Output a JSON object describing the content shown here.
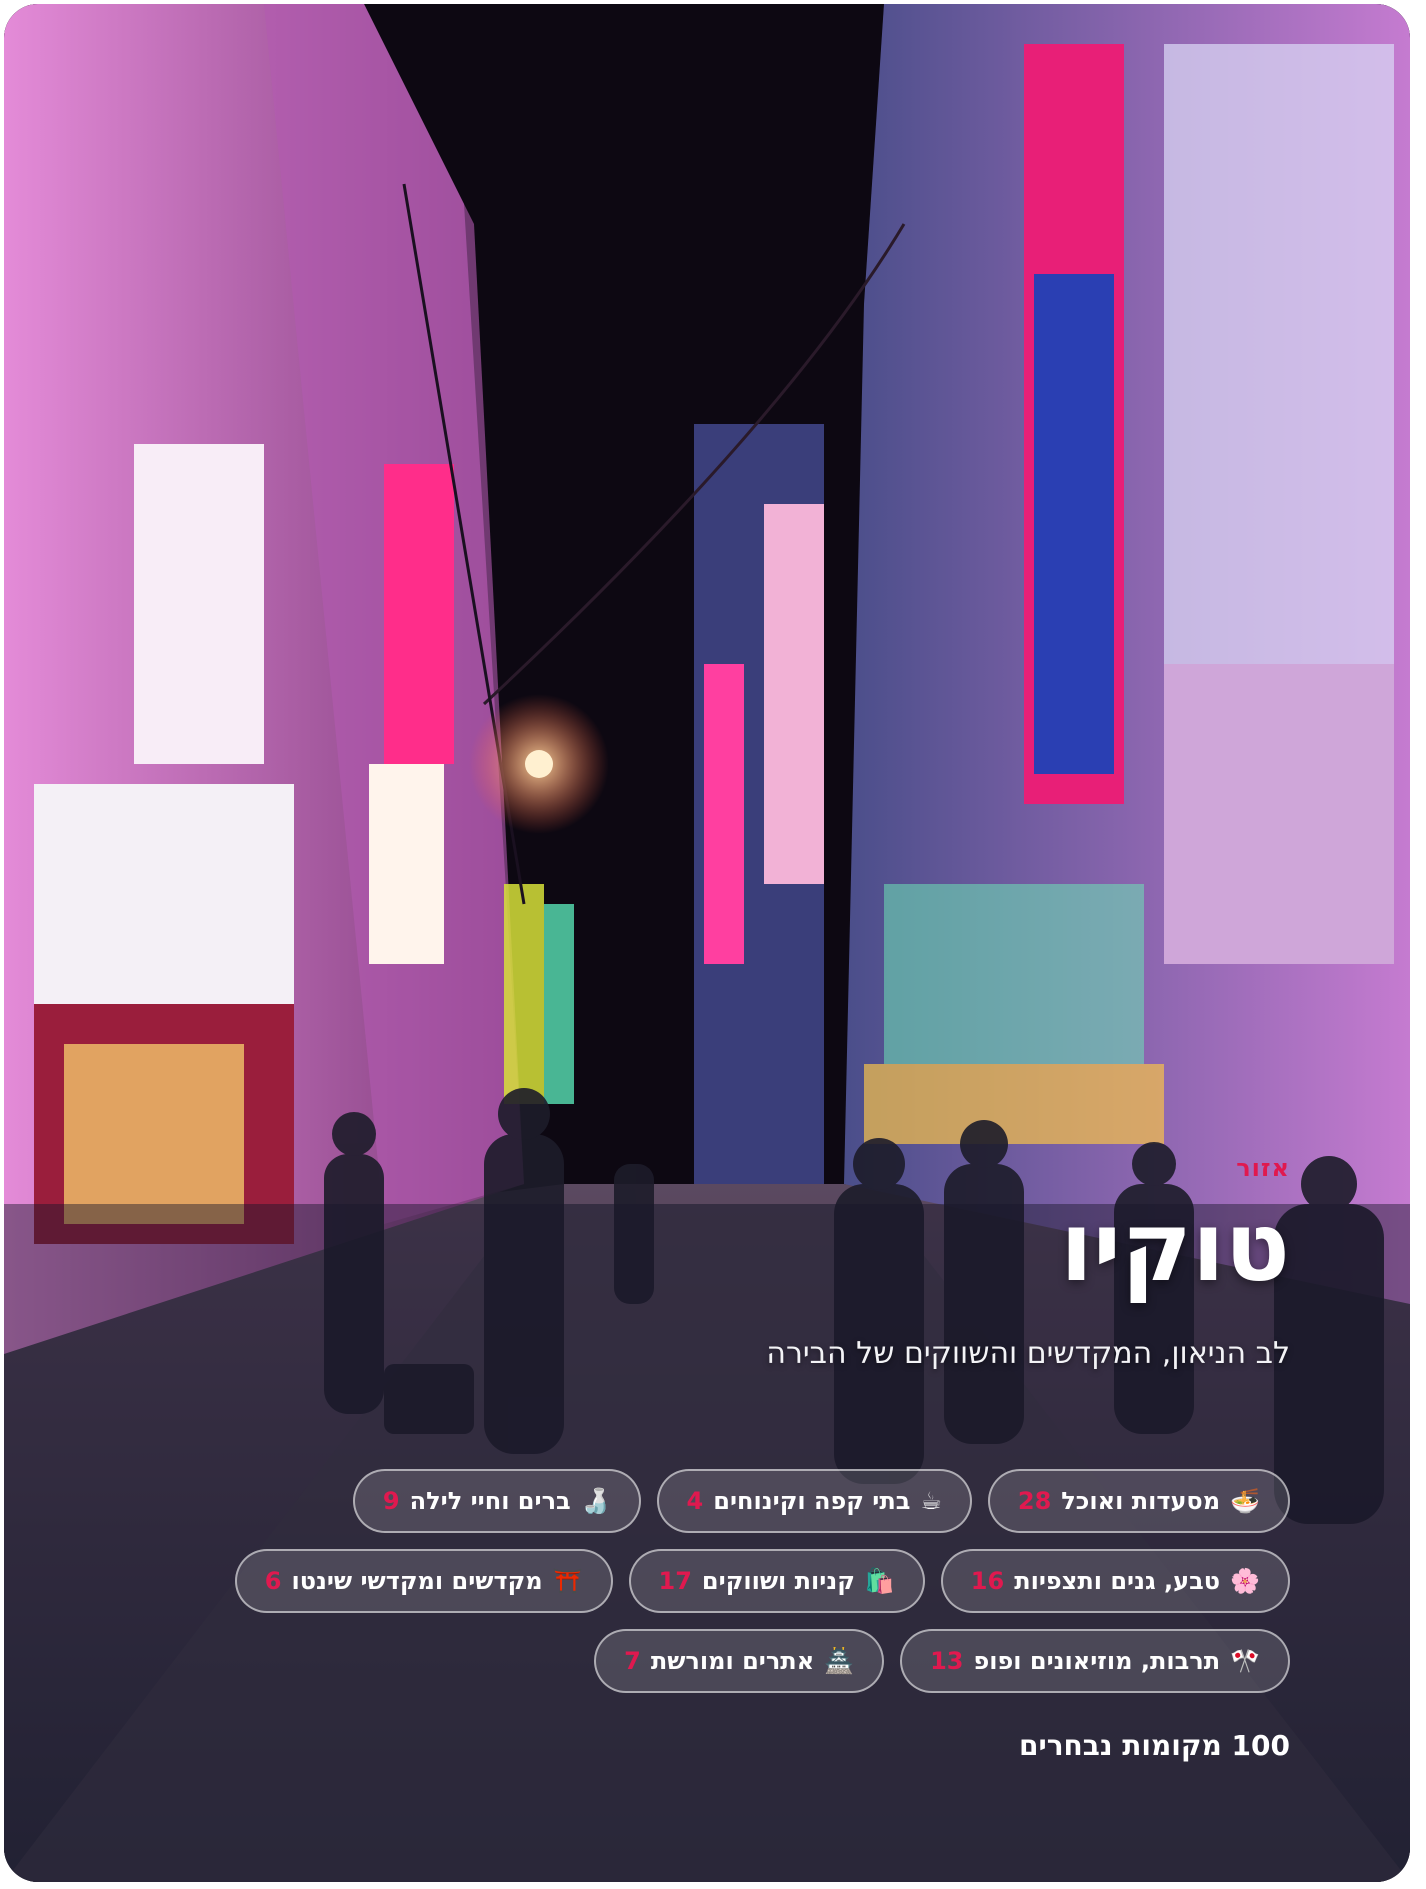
{
  "region": {
    "eyebrow": "אזור",
    "title": "טוקיו",
    "subtitle": "לב הניאון, המקדשים והשווקים של הבירה",
    "total_label": "100 מקומות נבחרים"
  },
  "colors": {
    "accent": "#e0194f",
    "text": "#ffffff"
  },
  "categories": [
    [
      {
        "icon": "🍜",
        "icon_name": "noodle-bowl-icon",
        "label": "מסעדות ואוכל",
        "count": "28"
      },
      {
        "icon": "☕",
        "icon_name": "coffee-icon",
        "label": "בתי קפה וקינוחים",
        "count": "4"
      },
      {
        "icon": "🍶",
        "icon_name": "sake-icon",
        "label": "ברים וחיי לילה",
        "count": "9"
      }
    ],
    [
      {
        "icon": "🌸",
        "icon_name": "cherry-blossom-icon",
        "label": "טבע, גנים ותצפיות",
        "count": "16"
      },
      {
        "icon": "🛍️",
        "icon_name": "shopping-bags-icon",
        "label": "קניות ושווקים",
        "count": "17"
      },
      {
        "icon": "⛩️",
        "icon_name": "torii-gate-icon",
        "label": "מקדשים ומקדשי שינטו",
        "count": "6"
      }
    ],
    [
      {
        "icon": "🎌",
        "icon_name": "crossed-flags-icon",
        "label": "תרבות, מוזיאונים ופופ",
        "count": "13"
      },
      {
        "icon": "🏯",
        "icon_name": "castle-icon",
        "label": "אתרים ומורשת",
        "count": "7"
      }
    ]
  ]
}
